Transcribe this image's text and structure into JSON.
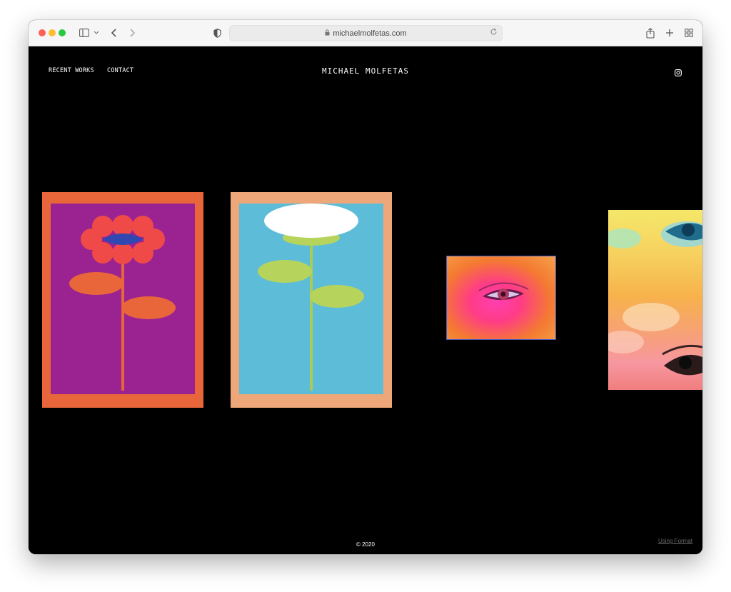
{
  "browser": {
    "url": "michaelmolfetas.com",
    "icons": [
      "sidebar-icon",
      "chevron-down-icon",
      "back-icon",
      "forward-icon",
      "shield-icon",
      "lock-icon",
      "reload-icon",
      "share-icon",
      "plus-icon",
      "tabs-grid-icon"
    ]
  },
  "site": {
    "nav": {
      "recent_works": "RECENT WORKS",
      "contact": "CONTACT"
    },
    "title": "MICHAEL MOLFETAS",
    "social_icon": "instagram-icon",
    "footer": "© 2020",
    "badge": "Using Format"
  },
  "colors": {
    "background": "#000000",
    "frame1": "#e8663a",
    "art1": "#9b2391",
    "frame2": "#eda778",
    "art2": "#5dbcd8"
  }
}
